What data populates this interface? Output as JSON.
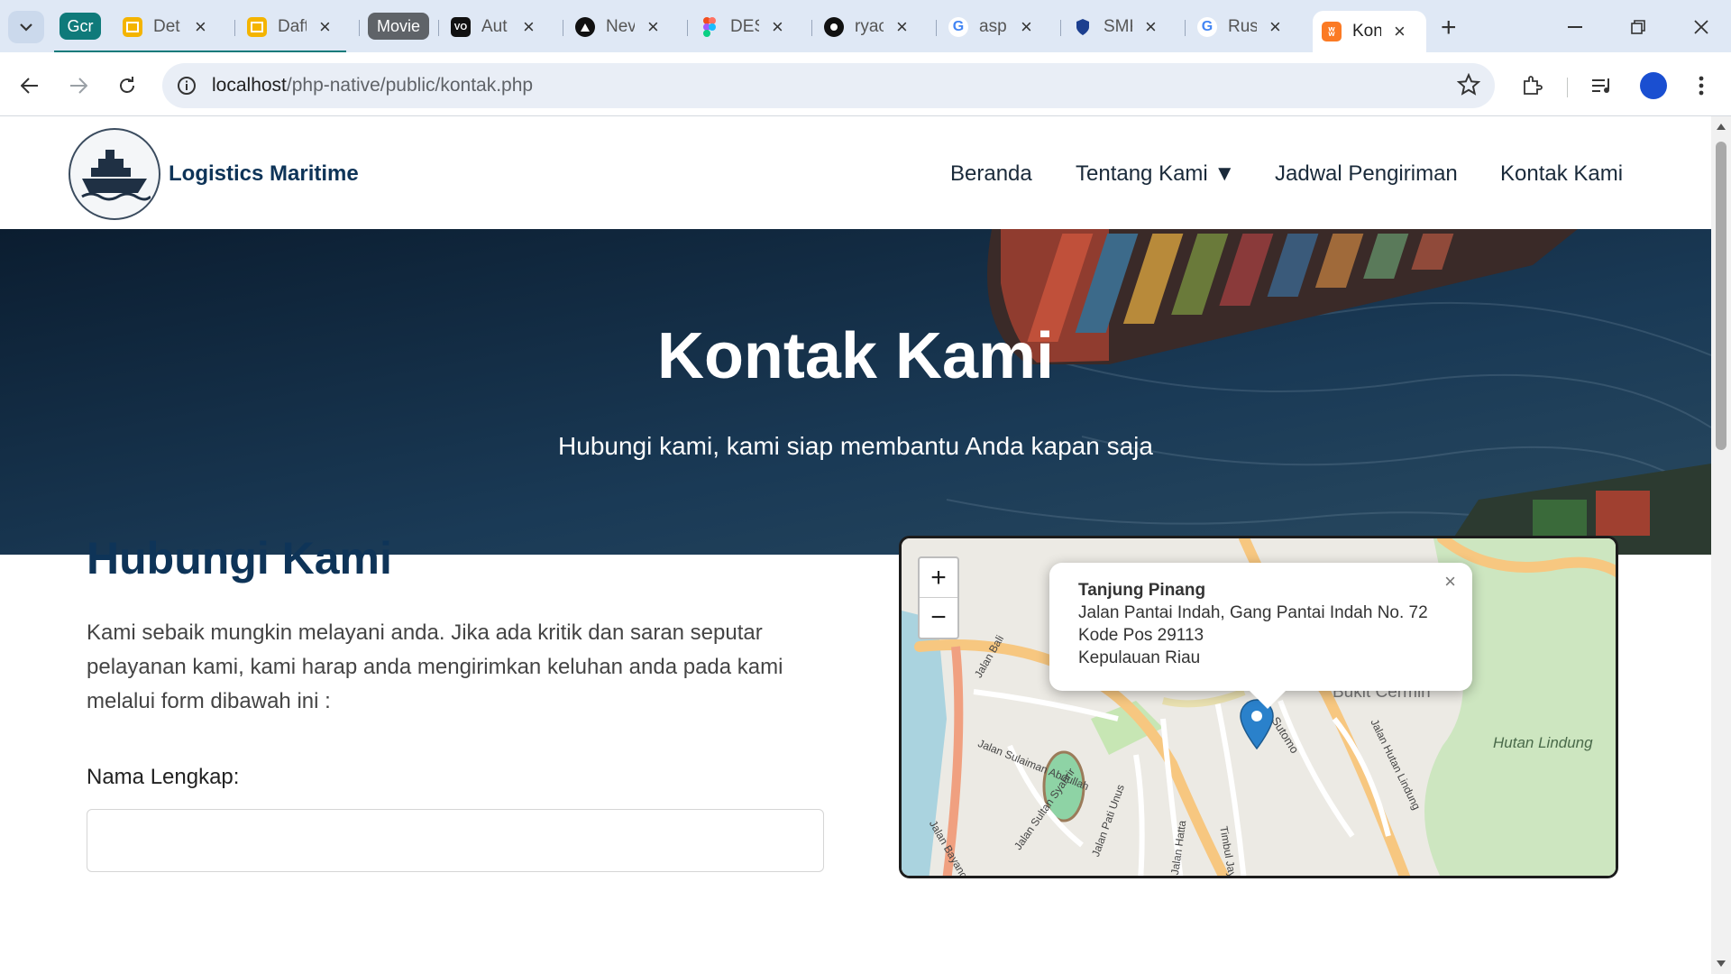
{
  "browser": {
    "tab_group_label": "Gcr",
    "tabs": [
      {
        "label": "Det",
        "icon": "slides-icon"
      },
      {
        "label": "Daft",
        "icon": "slides-icon"
      },
      {
        "label": "Aut",
        "icon": "vercel-icon"
      },
      {
        "label": "Nev",
        "icon": "triangle-icon"
      },
      {
        "label": "DES",
        "icon": "figma-icon"
      },
      {
        "label": "ryac",
        "icon": "github-icon"
      },
      {
        "label": "asp",
        "icon": "google-icon"
      },
      {
        "label": "SMK",
        "icon": "shield-icon"
      },
      {
        "label": "Rus",
        "icon": "google-icon"
      },
      {
        "label": "Kon",
        "icon": "xampp-icon"
      }
    ],
    "movie_chip": "Movie",
    "url_host": "localhost",
    "url_path": "/php-native/public/kontak.php",
    "colors": {
      "group_teal": "#0f7a7a",
      "movie_chip": "#5f6368"
    }
  },
  "site": {
    "brand": "Logistics Maritime",
    "nav": {
      "home": "Beranda",
      "about": "Tentang Kami ▼",
      "schedule": "Jadwal Pengiriman",
      "contact": "Kontak Kami"
    }
  },
  "hero": {
    "title": "Kontak Kami",
    "subtitle": "Hubungi kami, kami siap membantu Anda kapan saja"
  },
  "contact": {
    "heading": "Hubungi Kami",
    "description": "Kami sebaik mungkin melayani anda. Jika ada kritik dan saran seputar pelayanan kami, kami harap anda mengirimkan keluhan anda pada kami melalui form dibawah ini :",
    "full_name_label": "Nama Lengkap:",
    "full_name_value": ""
  },
  "map": {
    "zoom_in": "+",
    "zoom_out": "−",
    "popup": {
      "title": "Tanjung Pinang",
      "address": "Jalan Pantai Indah, Gang Pantai Indah No. 72",
      "postal": "Kode Pos 29113",
      "region": "Kepulauan Riau",
      "close": "×"
    },
    "labels": {
      "forest": "Hutan Lindung",
      "area": "Bukit Cermin",
      "street_1": "Jalan Sulaiman Abdullah",
      "street_2": "Jalan Sultan Syahrir",
      "street_3": "Jalan Pati Unus",
      "street_4": "Jalan Hatta",
      "street_5": "Timbul Jaya",
      "street_6": "Sutomo",
      "street_7": "Jalan Hutan Lindung",
      "street_8": "Jalan Bayang",
      "street_9": "Jalan Bali"
    }
  }
}
